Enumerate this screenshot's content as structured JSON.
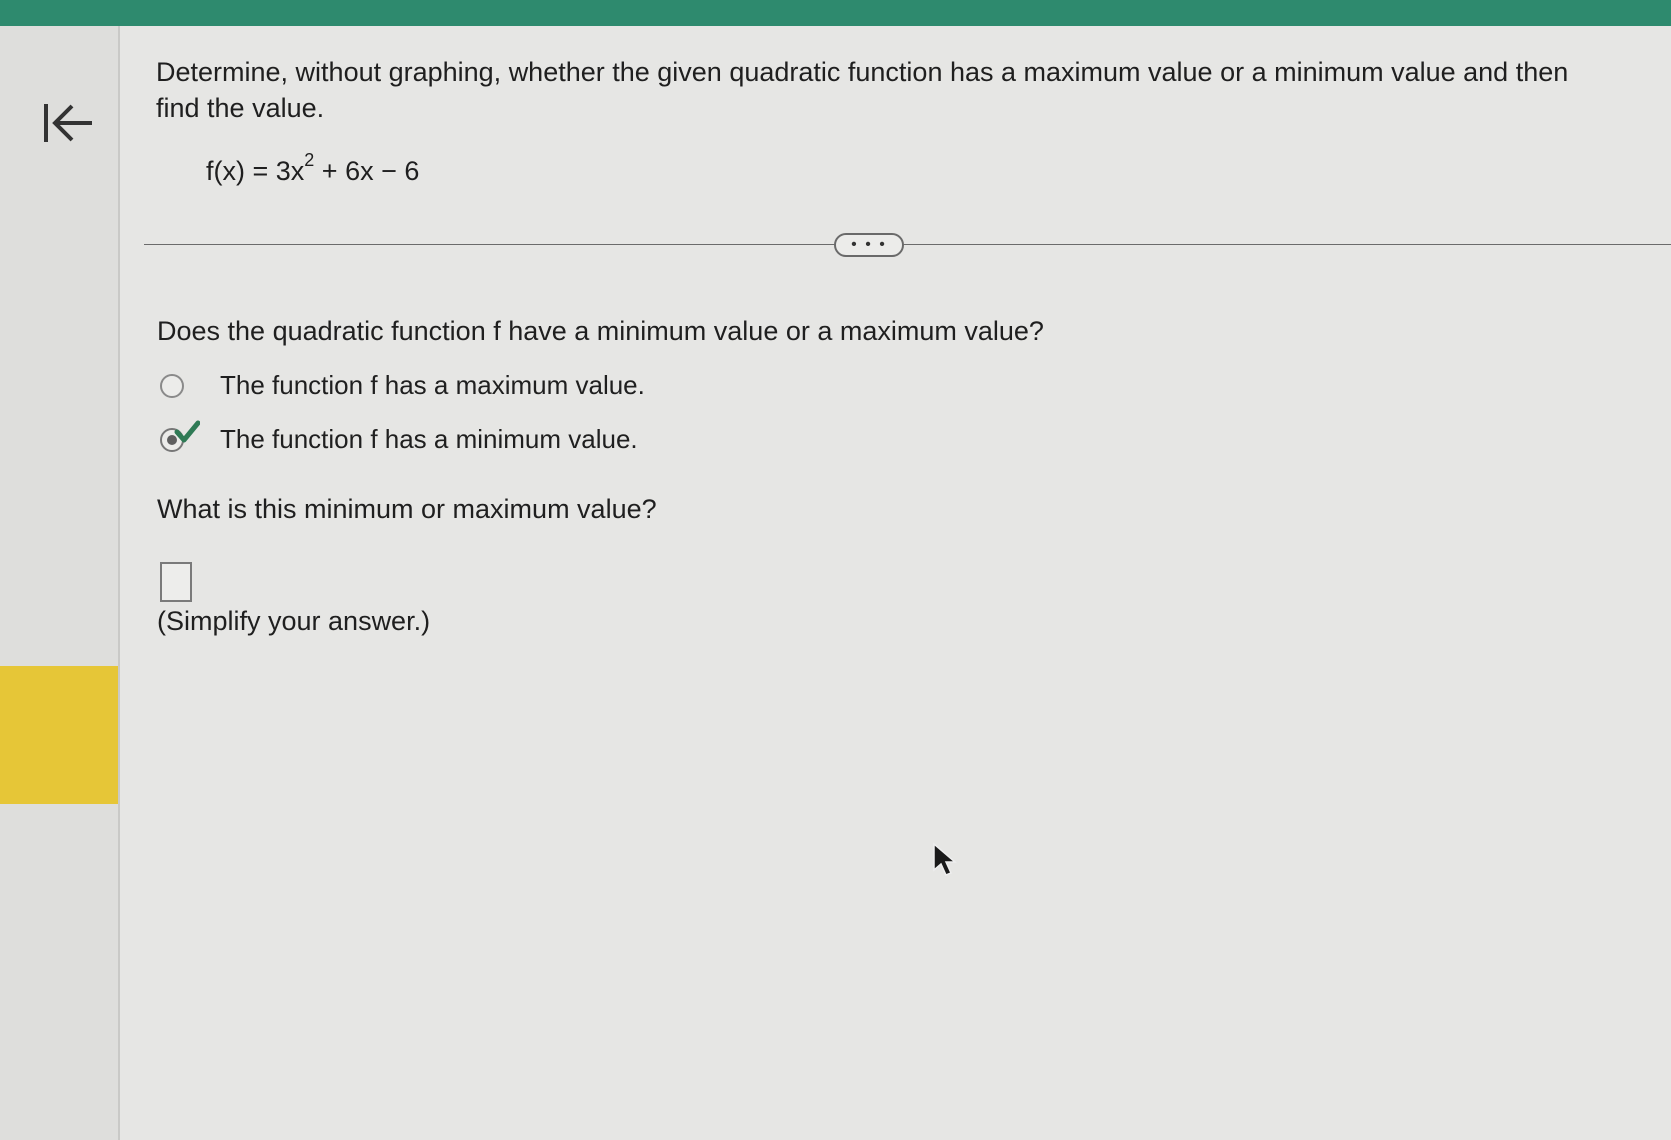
{
  "instruction": "Determine, without graphing, whether the given quadratic function has a maximum value or a minimum value and then find the value.",
  "formula": {
    "lhs": "f(x) = 3x",
    "exponent": "2",
    "rhs": " + 6x − 6"
  },
  "more_button": "• • •",
  "question1": "Does the quadratic function f have a minimum value or a maximum value?",
  "options": [
    {
      "label": "The function f has a maximum value.",
      "selected": false
    },
    {
      "label": "The function f has a minimum value.",
      "selected": true
    }
  ],
  "question2": "What is this minimum or maximum value?",
  "answer_value": "",
  "hint": "(Simplify your answer.)",
  "colors": {
    "topbar": "#2e8a6e",
    "highlight": "#e6c637",
    "check": "#2f7a55"
  },
  "icons": [
    "back-to-start-icon",
    "check-mark-icon",
    "mouse-pointer-icon"
  ]
}
